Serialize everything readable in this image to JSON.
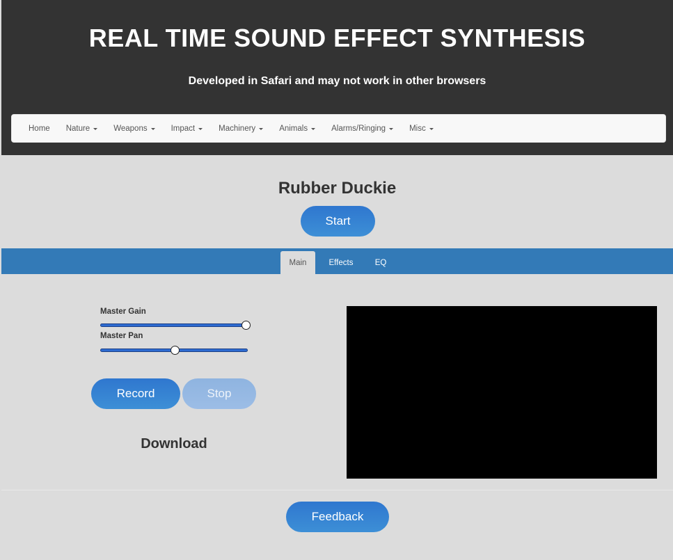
{
  "header": {
    "title": "REAL TIME SOUND EFFECT SYNTHESIS",
    "subtitle": "Developed in Safari and may not work in other browsers"
  },
  "navbar": {
    "items": [
      {
        "label": "Home",
        "dropdown": false
      },
      {
        "label": "Nature",
        "dropdown": true
      },
      {
        "label": "Weapons",
        "dropdown": true
      },
      {
        "label": "Impact",
        "dropdown": true
      },
      {
        "label": "Machinery",
        "dropdown": true
      },
      {
        "label": "Animals",
        "dropdown": true
      },
      {
        "label": "Alarms/Ringing",
        "dropdown": true
      },
      {
        "label": "Misc",
        "dropdown": true
      }
    ]
  },
  "effect": {
    "title": "Rubber Duckie",
    "start_label": "Start"
  },
  "tabs": [
    {
      "label": "Main",
      "active": true
    },
    {
      "label": "Effects",
      "active": false
    },
    {
      "label": "EQ",
      "active": false
    }
  ],
  "controls": {
    "master_gain": {
      "label": "Master Gain",
      "value": 1.0
    },
    "master_pan": {
      "label": "Master Pan",
      "value": 0.5
    },
    "record_label": "Record",
    "stop_label": "Stop",
    "download_label": "Download"
  },
  "footer": {
    "feedback_label": "Feedback"
  },
  "colors": {
    "header_bg": "#333333",
    "accent": "#337ab7",
    "button_blue": "#2f77cf",
    "page_bg": "#dcdcdc"
  }
}
